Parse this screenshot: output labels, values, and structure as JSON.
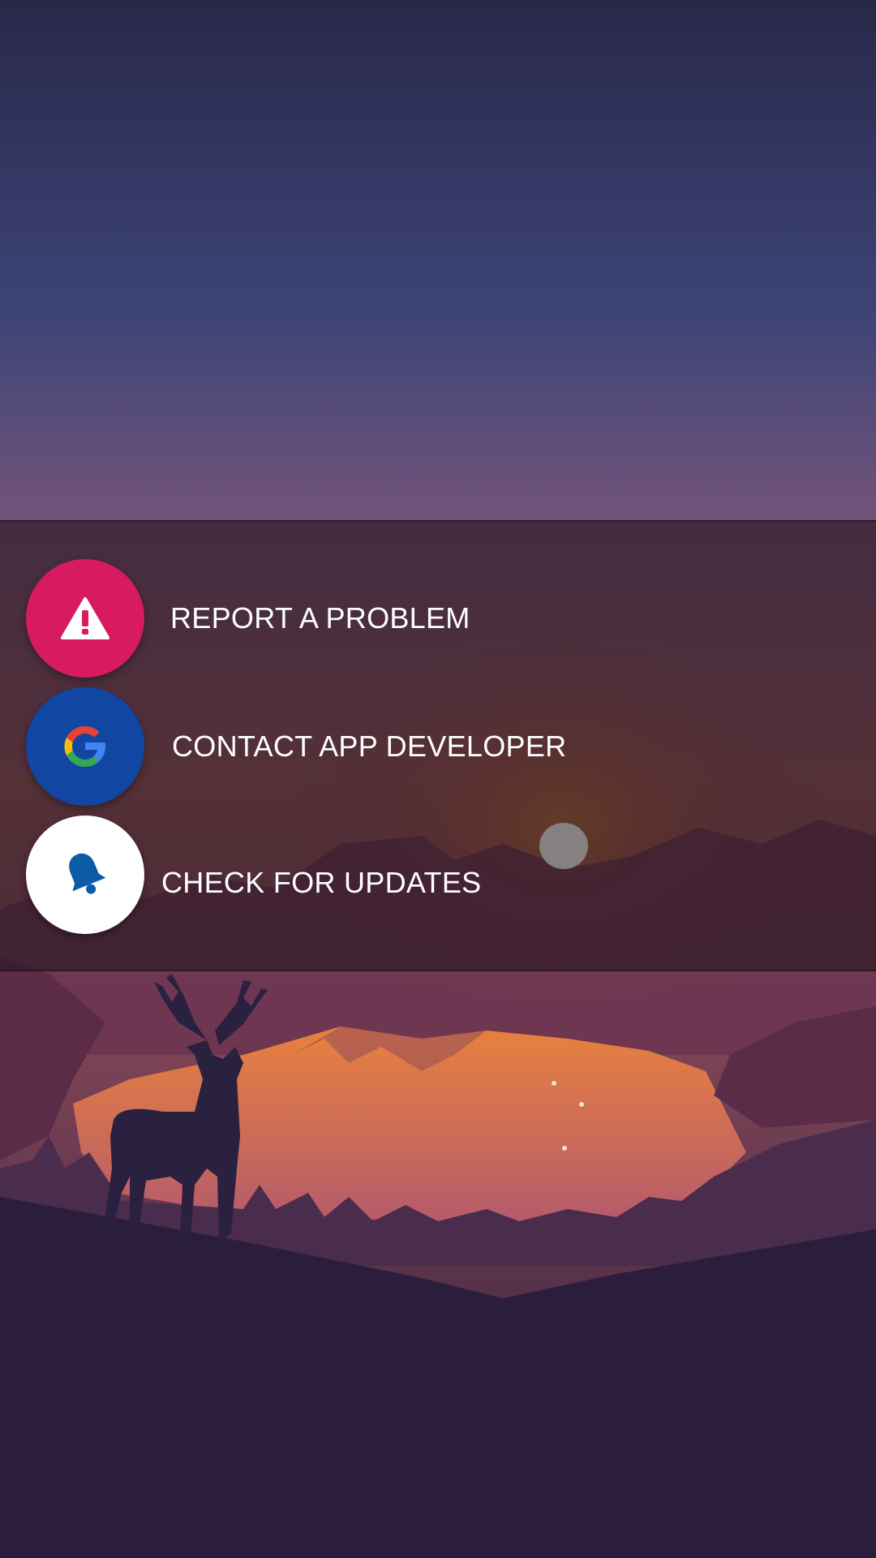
{
  "menu": {
    "items": [
      {
        "label": "REPORT A PROBLEM",
        "icon": "warning-icon",
        "circle_color": "#d81b60"
      },
      {
        "label": "CONTACT APP DEVELOPER",
        "icon": "google-g-icon",
        "circle_color": "#1146a3"
      },
      {
        "label": "CHECK FOR UPDATES",
        "icon": "bell-icon",
        "circle_color": "#ffffff"
      }
    ]
  },
  "wallpaper": {
    "icon": "deer-landscape-wallpaper",
    "sky_top": "#2b2a4e",
    "sky_mid": "#3d4576",
    "sky_horizon": "#8a5a78",
    "lake": "#e07b45",
    "ground": "#2a1e3c"
  },
  "colors": {
    "panel_overlay": "rgba(38,22,32,0.62)",
    "label_text": "#ffffff",
    "bell_blue": "#0d5aa7"
  }
}
